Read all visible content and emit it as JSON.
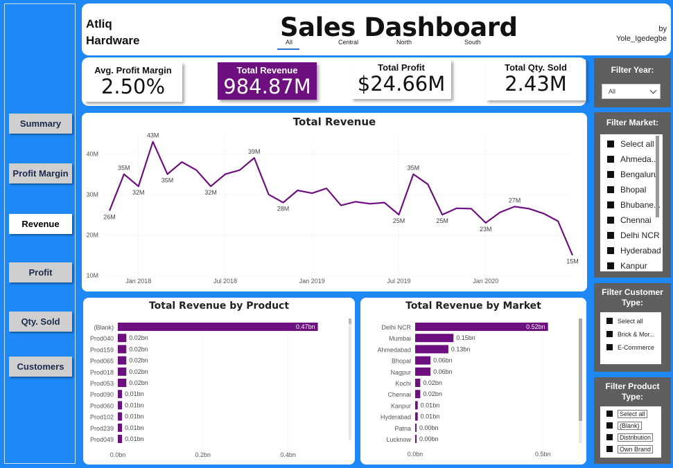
{
  "nav": [
    "Summary",
    "Profit Margin",
    "Revenue",
    "Profit",
    "Qty. Sold",
    "Customers"
  ],
  "header": {
    "brand_line1": "Atliq",
    "brand_line2": "Hardware",
    "title": "Sales Dashboard",
    "by": "by",
    "author": "Yole_Igedegbe",
    "tabs": [
      "All",
      "Central",
      "North",
      "South"
    ]
  },
  "kpis": {
    "profit_margin": {
      "label": "Avg. Profit Margin",
      "value": "2.50%"
    },
    "revenue": {
      "label": "Total Revenue",
      "value": "984.87M"
    },
    "profit": {
      "label": "Total Profit",
      "value": "$24.66M"
    },
    "qty": {
      "label": "Total Qty. Sold",
      "value": "2.43M"
    }
  },
  "filters": {
    "year": {
      "title": "Filter Year:",
      "value": "All"
    },
    "market": {
      "title": "Filter Market:",
      "items": [
        "Select all",
        "Ahmeda...",
        "Bengaluru",
        "Bhopal",
        "Bhubane...",
        "Chennai",
        "Delhi NCR",
        "Hyderabad",
        "Kanpur"
      ]
    },
    "customer_type": {
      "title_line1": "Filter Customer",
      "title_line2": "Type:",
      "items": [
        "Select all",
        "Brick & Mor...",
        "E-Commerce"
      ]
    },
    "product_type": {
      "title_line1": "Filter Product",
      "title_line2": "Type:",
      "items": [
        "Select all",
        "(Blank)",
        "Distribution",
        "Own Brand"
      ]
    }
  },
  "colors": {
    "accent": "#6E0F7F",
    "background": "#1E88F7",
    "panel": "#5f5f5f"
  },
  "chart_data": [
    {
      "type": "line",
      "title": "Total Revenue",
      "x_ticks": [
        "Jan 2018",
        "Jul 2018",
        "Jan 2019",
        "Jul 2019",
        "Jan 2020"
      ],
      "y_ticks": [
        "10M",
        "20M",
        "30M",
        "40M"
      ],
      "ylim": [
        10,
        45
      ],
      "values": [
        26,
        35,
        32,
        43,
        35,
        38,
        36,
        32,
        35,
        36,
        39,
        30,
        28,
        31,
        30.3,
        31.5,
        27.3,
        28.2,
        27.7,
        28,
        25,
        35,
        32.5,
        25,
        26.6,
        26.5,
        23,
        25.6,
        27,
        26.5,
        25.3,
        23.4,
        15
      ],
      "labels": [
        {
          "i": 0,
          "text": "26M",
          "pos": "below"
        },
        {
          "i": 1,
          "text": "35M",
          "pos": "above"
        },
        {
          "i": 2,
          "text": "32M",
          "pos": "below"
        },
        {
          "i": 3,
          "text": "43M",
          "pos": "above"
        },
        {
          "i": 4,
          "text": "35M",
          "pos": "below"
        },
        {
          "i": 7,
          "text": "32M",
          "pos": "below"
        },
        {
          "i": 10,
          "text": "39M",
          "pos": "above"
        },
        {
          "i": 12,
          "text": "28M",
          "pos": "below"
        },
        {
          "i": 20,
          "text": "25M",
          "pos": "below"
        },
        {
          "i": 21,
          "text": "35M",
          "pos": "above"
        },
        {
          "i": 23,
          "text": "25M",
          "pos": "below"
        },
        {
          "i": 26,
          "text": "23M",
          "pos": "below"
        },
        {
          "i": 28,
          "text": "27M",
          "pos": "above"
        },
        {
          "i": 32,
          "text": "15M",
          "pos": "below"
        }
      ]
    },
    {
      "type": "bar",
      "title": "Total Revenue by Product",
      "categories": [
        "(Blank)",
        "Prod040",
        "Prod159",
        "Prod065",
        "Prod018",
        "Prod053",
        "Prod090",
        "Prod060",
        "Prod102",
        "Prod239",
        "Prod049"
      ],
      "values": [
        0.47,
        0.02,
        0.02,
        0.02,
        0.02,
        0.02,
        0.01,
        0.01,
        0.01,
        0.01,
        0.01
      ],
      "labels": [
        "0.47bn",
        "0.02bn",
        "0.02bn",
        "0.02bn",
        "0.02bn",
        "0.02bn",
        "0.01bn",
        "0.01bn",
        "0.01bn",
        "0.01bn",
        "0.01bn"
      ],
      "x_ticks": [
        "0.0bn",
        "0.2bn",
        "0.4bn"
      ],
      "xlim": [
        0,
        0.5
      ]
    },
    {
      "type": "bar",
      "title": "Total Revenue by Market",
      "categories": [
        "Delhi NCR",
        "Mumbai",
        "Ahmedabad",
        "Bhopal",
        "Nagpur",
        "Kochi",
        "Chennai",
        "Kanpur",
        "Hyderabad",
        "Patna",
        "Lucknow"
      ],
      "values": [
        0.52,
        0.15,
        0.13,
        0.06,
        0.06,
        0.02,
        0.02,
        0.01,
        0.01,
        0.0,
        0.0
      ],
      "labels": [
        "0.52bn",
        "0.15bn",
        "0.13bn",
        "0.06bn",
        "0.06bn",
        "0.02bn",
        "0.02bn",
        "0.01bn",
        "0.01bn",
        "0.00bn",
        "0.00bn"
      ],
      "x_ticks": [
        "0.0bn",
        "0.5bn"
      ],
      "xlim": [
        0,
        0.54
      ]
    }
  ]
}
